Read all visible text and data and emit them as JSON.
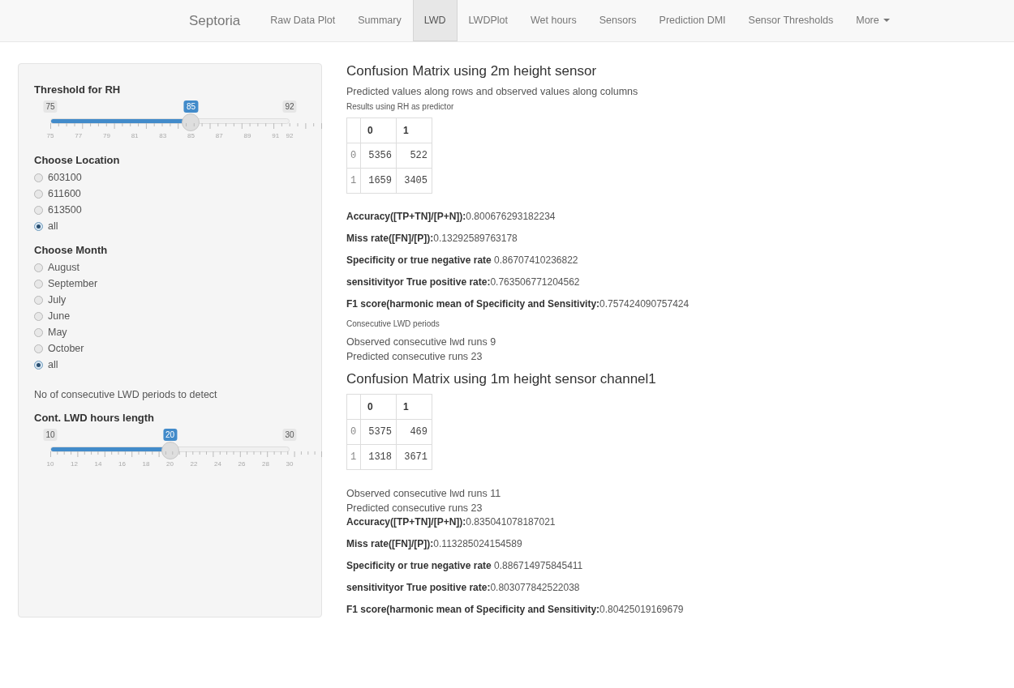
{
  "navbar": {
    "brand": "Septoria",
    "tabs": [
      {
        "label": "Raw Data Plot",
        "selected": false,
        "kind": "link"
      },
      {
        "label": "Summary",
        "selected": false,
        "kind": "link"
      },
      {
        "label": "LWD",
        "selected": true,
        "kind": "link"
      },
      {
        "label": "LWDPlot",
        "selected": false,
        "kind": "link"
      },
      {
        "label": "Wet hours",
        "selected": false,
        "kind": "link"
      },
      {
        "label": "Sensors",
        "selected": false,
        "kind": "link"
      },
      {
        "label": "Prediction DMI",
        "selected": false,
        "kind": "link"
      },
      {
        "label": "Sensor Thresholds",
        "selected": false,
        "kind": "link"
      },
      {
        "label": "More",
        "selected": false,
        "kind": "dropdown"
      }
    ]
  },
  "sidebar": {
    "controls": [
      {
        "kind": "slider",
        "label": "Threshold for RH",
        "min": "75",
        "max": "92",
        "value": "85",
        "level": 0.588,
        "ticks": [
          "75",
          "77",
          "79",
          "81",
          "83",
          "85",
          "87",
          "89",
          "91",
          "92"
        ]
      },
      {
        "kind": "radio",
        "label": "Choose Location",
        "options": [
          {
            "label": "603100",
            "selected": false
          },
          {
            "label": "611600",
            "selected": false
          },
          {
            "label": "613500",
            "selected": false
          },
          {
            "label": "all",
            "selected": true
          }
        ]
      },
      {
        "kind": "radio",
        "label": "Choose Month",
        "options": [
          {
            "label": "August",
            "selected": false
          },
          {
            "label": "September",
            "selected": false
          },
          {
            "label": "July",
            "selected": false
          },
          {
            "label": "June",
            "selected": false
          },
          {
            "label": "May",
            "selected": false
          },
          {
            "label": "October",
            "selected": false
          },
          {
            "label": "all",
            "selected": true
          }
        ]
      },
      {
        "kind": "text",
        "text": "No of consecutive LWD periods to detect"
      },
      {
        "kind": "slider",
        "label": "Cont. LWD hours length",
        "min": "10",
        "max": "30",
        "value": "20",
        "level": 0.5,
        "ticks": [
          "10",
          "12",
          "14",
          "16",
          "18",
          "20",
          "22",
          "24",
          "26",
          "28",
          "30"
        ]
      }
    ]
  },
  "main": {
    "blocks": [
      {
        "kind": "heading",
        "text": "Confusion Matrix using 2m height sensor"
      },
      {
        "kind": "text",
        "text": "Predicted values along rows and observed values along columns"
      },
      {
        "kind": "note",
        "text": "Results using RH as predictor"
      },
      {
        "kind": "matrix",
        "columns": [
          "0",
          "1"
        ],
        "rows": [
          {
            "label": "0",
            "cells": [
              "5356",
              "522"
            ]
          },
          {
            "label": "1",
            "cells": [
              "1659",
              "3405"
            ]
          }
        ]
      },
      {
        "kind": "metric",
        "text": "**Accuracy([TP+TN]/[P+N]):**0.800676293182234"
      },
      {
        "kind": "metric",
        "text": "**Miss rate([FN]/[P]):**0.13292589763178"
      },
      {
        "kind": "metric",
        "text": "**Specificity or true negative rate** 0.86707410236822"
      },
      {
        "kind": "metric",
        "text": "**sensitivityor True positive rate:**0.763506771204562"
      },
      {
        "kind": "metric",
        "text": "**F1 score(harmonic mean of Specificity and Sensitivity:**0.757424090757424"
      },
      {
        "kind": "note",
        "text": "Consecutive LWD periods"
      },
      {
        "kind": "line",
        "text": "Observed consecutive lwd runs 9"
      },
      {
        "kind": "line",
        "text": "Predicted consecutive runs 23"
      },
      {
        "kind": "heading",
        "text": "Confusion Matrix using 1m height sensor channel1"
      },
      {
        "kind": "matrix",
        "columns": [
          "0",
          "1"
        ],
        "rows": [
          {
            "label": "0",
            "cells": [
              "5375",
              "469"
            ]
          },
          {
            "label": "1",
            "cells": [
              "1318",
              "3671"
            ]
          }
        ]
      },
      {
        "kind": "line",
        "text": "Observed consecutive lwd runs 11"
      },
      {
        "kind": "line",
        "text": "Predicted consecutive runs 23"
      },
      {
        "kind": "metric",
        "text": "**Accuracy([TP+TN]/[P+N]):**0.835041078187021"
      },
      {
        "kind": "metric",
        "text": "**Miss rate([FN]/[P]):**0.113285024154589"
      },
      {
        "kind": "metric",
        "text": "**Specificity or true negative rate** 0.886714975845411"
      },
      {
        "kind": "metric",
        "text": "**sensitivityor True positive rate:**0.803077842522038"
      },
      {
        "kind": "metric",
        "text": "**F1 score(harmonic mean of Specificity and Sensitivity:**0.80425019169679"
      }
    ]
  }
}
